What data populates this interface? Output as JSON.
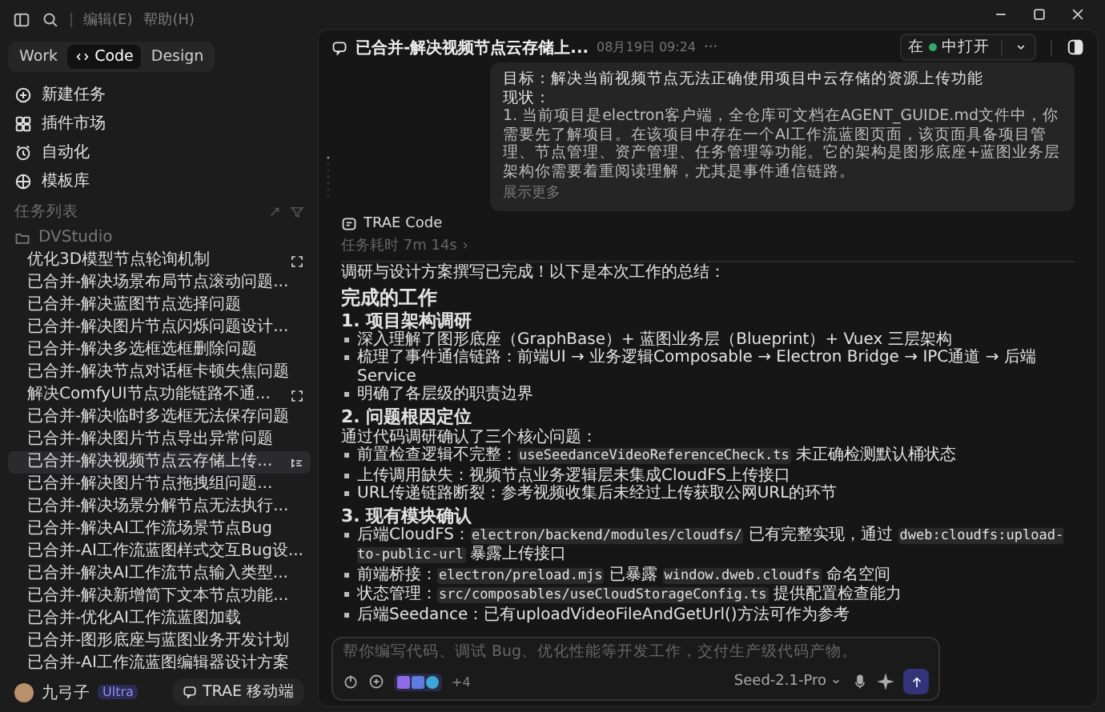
{
  "menu": [
    "编辑(E)",
    "帮助(H)"
  ],
  "mode_tabs": [
    {
      "label": "Work",
      "selected": false
    },
    {
      "label": "Code",
      "selected": true
    },
    {
      "label": "Design",
      "selected": false
    }
  ],
  "nav": [
    "新建任务",
    "插件市场",
    "自动化",
    "模板库"
  ],
  "task_list": {
    "title": "任务列表",
    "folder": "DVStudio",
    "items": [
      {
        "label": "优化3D模型节点轮询机制",
        "selected": false,
        "kind": "expand"
      },
      {
        "label": "已合并-解决场景布局节点滚动问题...",
        "selected": false,
        "kind": "plain"
      },
      {
        "label": "已合并-解决蓝图节点选择问题",
        "selected": false,
        "kind": "plain"
      },
      {
        "label": "已合并-解决图片节点闪烁问题设计...",
        "selected": false,
        "kind": "plain"
      },
      {
        "label": "已合并-解决多选框选框删除问题",
        "selected": false,
        "kind": "plain"
      },
      {
        "label": "已合并-解决节点对话框卡顿失焦问题",
        "selected": false,
        "kind": "plain"
      },
      {
        "label": "解决ComfyUI节点功能链路不通...",
        "selected": false,
        "kind": "expand"
      },
      {
        "label": "已合并-解决临时多选框无法保存问题",
        "selected": false,
        "kind": "plain"
      },
      {
        "label": "已合并-解决图片节点导出异常问题",
        "selected": false,
        "kind": "plain"
      },
      {
        "label": "已合并-解决视频节点云存储上传...",
        "selected": true,
        "kind": "menu"
      },
      {
        "label": "已合并-解决图片节点拖拽组问题...",
        "selected": false,
        "kind": "plain"
      },
      {
        "label": "已合并-解决场景分解节点无法执行...",
        "selected": false,
        "kind": "plain"
      },
      {
        "label": "已合并-解决AI工作流场景节点Bug",
        "selected": false,
        "kind": "plain"
      },
      {
        "label": "已合并-AI工作流蓝图样式交互Bug设...",
        "selected": false,
        "kind": "plain"
      },
      {
        "label": "已合并-解决AI工作流节点输入类型...",
        "selected": false,
        "kind": "plain"
      },
      {
        "label": "已合并-解决新增简下文本节点功能...",
        "selected": false,
        "kind": "plain"
      },
      {
        "label": "已合并-优化AI工作流蓝图加载",
        "selected": false,
        "kind": "plain"
      },
      {
        "label": "已合并-图形底座与蓝图业务开发计划",
        "selected": false,
        "kind": "plain"
      },
      {
        "label": "已合并-AI工作流蓝图编辑器设计方案",
        "selected": false,
        "kind": "plain"
      }
    ]
  },
  "user": {
    "name": "九弓子",
    "plan": "Ultra"
  },
  "mobile_button": "TRAE 移动端",
  "chat": {
    "title": "已合并-解决视频节点云存储上...",
    "time": "08月19日 09:24",
    "more_menu": "···",
    "open_in": {
      "prefix": "在",
      "suffix": "中打开"
    },
    "prompt": {
      "lines": [
        "目标：解决当前视频节点无法正确使用项目中云存储的资源上传功能",
        "现状：",
        "1. 当前项目是electron客户端，全仓库可文档在AGENT_GUIDE.md文件中，你需要先了解项目。在该项目中存在一个AI工作流蓝图页面，该页面具备项目管理、节点管理、资产管理、任务管理等功能。它的架构是图形底座+蓝图业务层架构你需要着重阅读理解，尤其是事件通信链路。"
      ],
      "more": "展示更多"
    },
    "agent": "TRAE Code",
    "duration": "任务耗时 7m 14s",
    "blocks": [
      {
        "kind": "p",
        "parts": [
          {
            "kind": "text",
            "text": "调研与设计方案撰写已完成！以下是本次工作的总结："
          }
        ]
      },
      {
        "kind": "h2",
        "parts": [
          {
            "kind": "text",
            "text": "完成的工作"
          }
        ]
      },
      {
        "kind": "h3",
        "parts": [
          {
            "kind": "text",
            "text": "1. 项目架构调研"
          }
        ]
      },
      {
        "kind": "li",
        "parts": [
          {
            "kind": "text",
            "text": "深入理解了图形底座（GraphBase）+ 蓝图业务层（Blueprint）+ Vuex 三层架构"
          }
        ]
      },
      {
        "kind": "li",
        "parts": [
          {
            "kind": "text",
            "text": "梳理了事件通信链路：前端UI → 业务逻辑Composable → Electron Bridge → IPC通道 → 后端Service"
          }
        ]
      },
      {
        "kind": "li",
        "parts": [
          {
            "kind": "text",
            "text": "明确了各层级的职责边界"
          }
        ]
      },
      {
        "kind": "h3",
        "parts": [
          {
            "kind": "text",
            "text": "2. 问题根因定位"
          }
        ]
      },
      {
        "kind": "p",
        "parts": [
          {
            "kind": "text",
            "text": "通过代码调研确认了三个核心问题："
          }
        ]
      },
      {
        "kind": "li",
        "parts": [
          {
            "kind": "text",
            "text": "前置检查逻辑不完整："
          },
          {
            "kind": "code",
            "text": "useSeedanceVideoReferenceCheck.ts"
          },
          {
            "kind": "text",
            "text": " 未正确检测默认桶状态"
          }
        ]
      },
      {
        "kind": "li",
        "parts": [
          {
            "kind": "text",
            "text": "上传调用缺失：视频节点业务逻辑层未集成CloudFS上传接口"
          }
        ]
      },
      {
        "kind": "li",
        "parts": [
          {
            "kind": "text",
            "text": "URL传递链路断裂：参考视频收集后未经过上传获取公网URL的环节"
          }
        ]
      },
      {
        "kind": "h3",
        "parts": [
          {
            "kind": "text",
            "text": "3. 现有模块确认"
          }
        ]
      },
      {
        "kind": "li",
        "parts": [
          {
            "kind": "text",
            "text": "后端CloudFS："
          },
          {
            "kind": "code",
            "text": "electron/backend/modules/cloudfs/"
          },
          {
            "kind": "text",
            "text": " 已有完整实现，通过 "
          },
          {
            "kind": "code",
            "text": "dweb:cloudfs:upload-to-public-url"
          },
          {
            "kind": "text",
            "text": " 暴露上传接口"
          }
        ]
      },
      {
        "kind": "li",
        "parts": [
          {
            "kind": "text",
            "text": "前端桥接："
          },
          {
            "kind": "code",
            "text": "electron/preload.mjs"
          },
          {
            "kind": "text",
            "text": " 已暴露 "
          },
          {
            "kind": "code",
            "text": "window.dweb.cloudfs"
          },
          {
            "kind": "text",
            "text": " 命名空间"
          }
        ]
      },
      {
        "kind": "li",
        "parts": [
          {
            "kind": "text",
            "text": "状态管理："
          },
          {
            "kind": "code",
            "text": "src/composables/useCloudStorageConfig.ts"
          },
          {
            "kind": "text",
            "text": " 提供配置检查能力"
          }
        ]
      },
      {
        "kind": "li",
        "parts": [
          {
            "kind": "text",
            "text": "后端Seedance：已有uploadVideoFileAndGetUrl()方法可作为参考"
          }
        ]
      }
    ]
  },
  "composer": {
    "placeholder": "帮你编写代码、调试 Bug、优化性能等开发工作，交付生产级代码产物。",
    "extra_count": "+4",
    "model": "Seed-2.1-Pro"
  }
}
